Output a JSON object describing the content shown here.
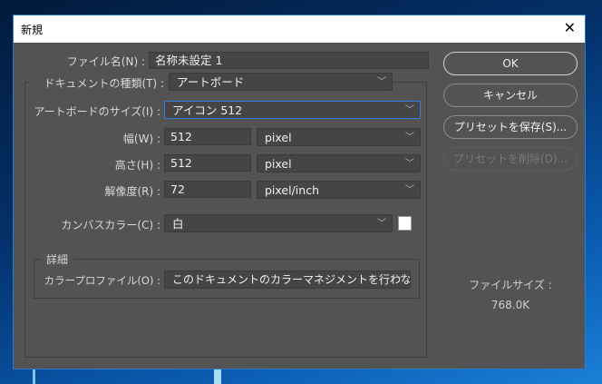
{
  "window": {
    "title": "新規",
    "close_icon": "close-icon"
  },
  "form": {
    "file_name": {
      "label": "ファイル名(N) :",
      "value": "名称未設定 1"
    },
    "doc_type": {
      "label": "ドキュメントの種類(T) :",
      "value": "アートボード"
    },
    "artboard_size": {
      "label": "アートボードのサイズ(I) :",
      "value": "アイコン 512"
    },
    "width": {
      "label": "幅(W) :",
      "value": "512",
      "unit": "pixel"
    },
    "height": {
      "label": "高さ(H) :",
      "value": "512",
      "unit": "pixel"
    },
    "resolution": {
      "label": "解像度(R) :",
      "value": "72",
      "unit": "pixel/inch"
    },
    "canvas_color": {
      "label": "カンバスカラー(C) :",
      "value": "白",
      "swatch": "#ffffff"
    },
    "advanced": {
      "title": "詳細",
      "profile_label": "カラープロファイル(O) :",
      "profile_value": "このドキュメントのカラーマネジメントを行わない"
    }
  },
  "buttons": {
    "ok": "OK",
    "cancel": "キャンセル",
    "save_preset": "プリセットを保存(S)...",
    "delete_preset": "プリセットを削除(D)..."
  },
  "file_size": {
    "label": "ファイルサイズ :",
    "value": "768.0K"
  }
}
